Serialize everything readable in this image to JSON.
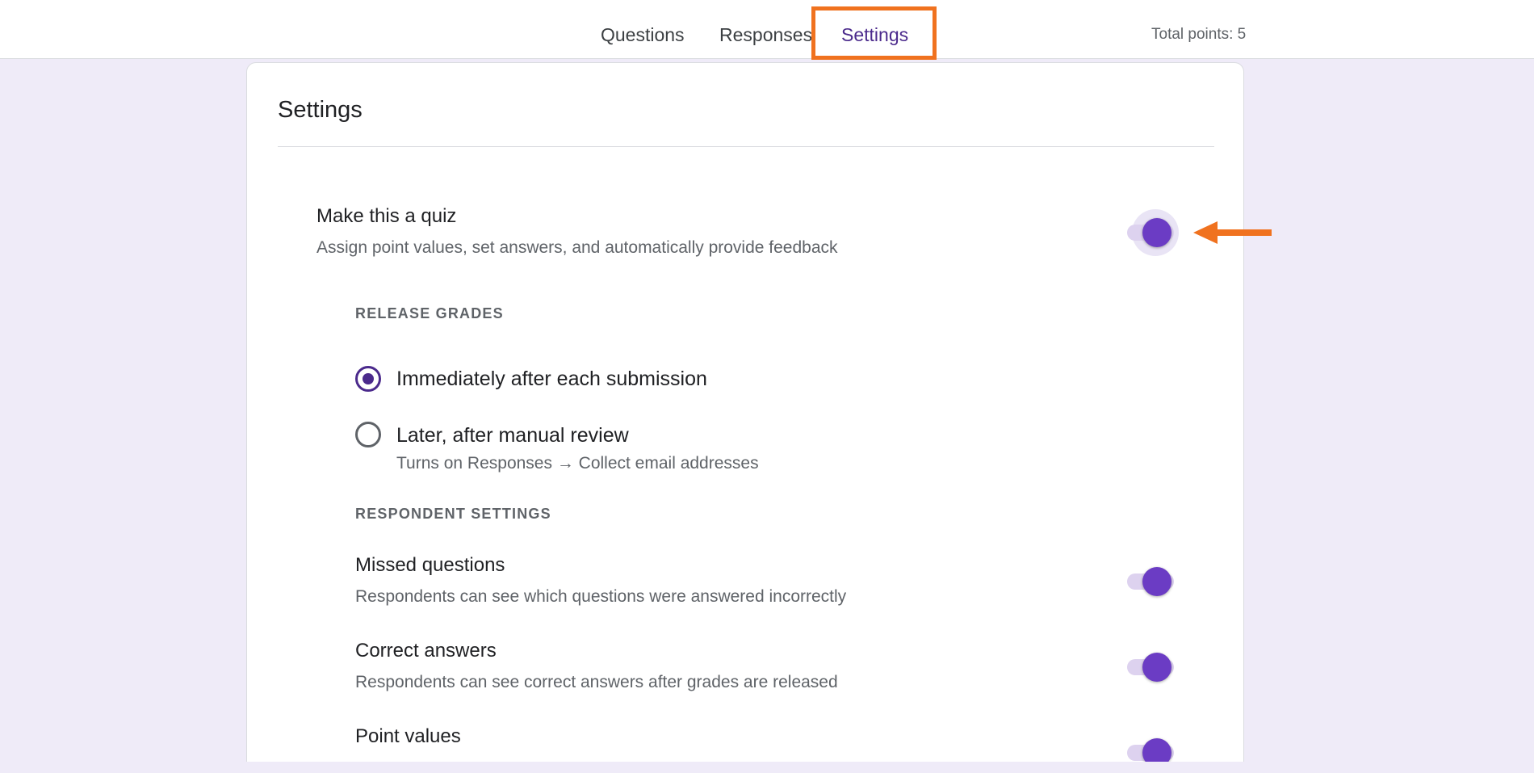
{
  "tabs": {
    "questions": "Questions",
    "responses": "Responses",
    "settings": "Settings"
  },
  "total_points": "Total points: 5",
  "card": {
    "title": "Settings"
  },
  "quiz": {
    "title": "Make this a quiz",
    "description": "Assign point values, set answers, and automatically provide feedback",
    "enabled": true
  },
  "release_grades": {
    "label": "RELEASE GRADES",
    "options": [
      {
        "label": "Immediately after each submission",
        "selected": true
      },
      {
        "label": "Later, after manual review",
        "sub": "Turns on Responses → Collect email addresses",
        "selected": false
      }
    ]
  },
  "respondent_settings": {
    "label": "RESPONDENT SETTINGS",
    "items": [
      {
        "title": "Missed questions",
        "description": "Respondents can see which questions were answered incorrectly",
        "enabled": true
      },
      {
        "title": "Correct answers",
        "description": "Respondents can see correct answers after grades are released",
        "enabled": true
      },
      {
        "title": "Point values",
        "description": "",
        "enabled": true
      }
    ]
  },
  "colors": {
    "accent": "#6b3cc4",
    "accent_dark": "#4b2a8c",
    "highlight": "#f0721f",
    "background": "#efebf8"
  },
  "icons": {
    "annotation_arrow": "arrow-left-icon"
  }
}
